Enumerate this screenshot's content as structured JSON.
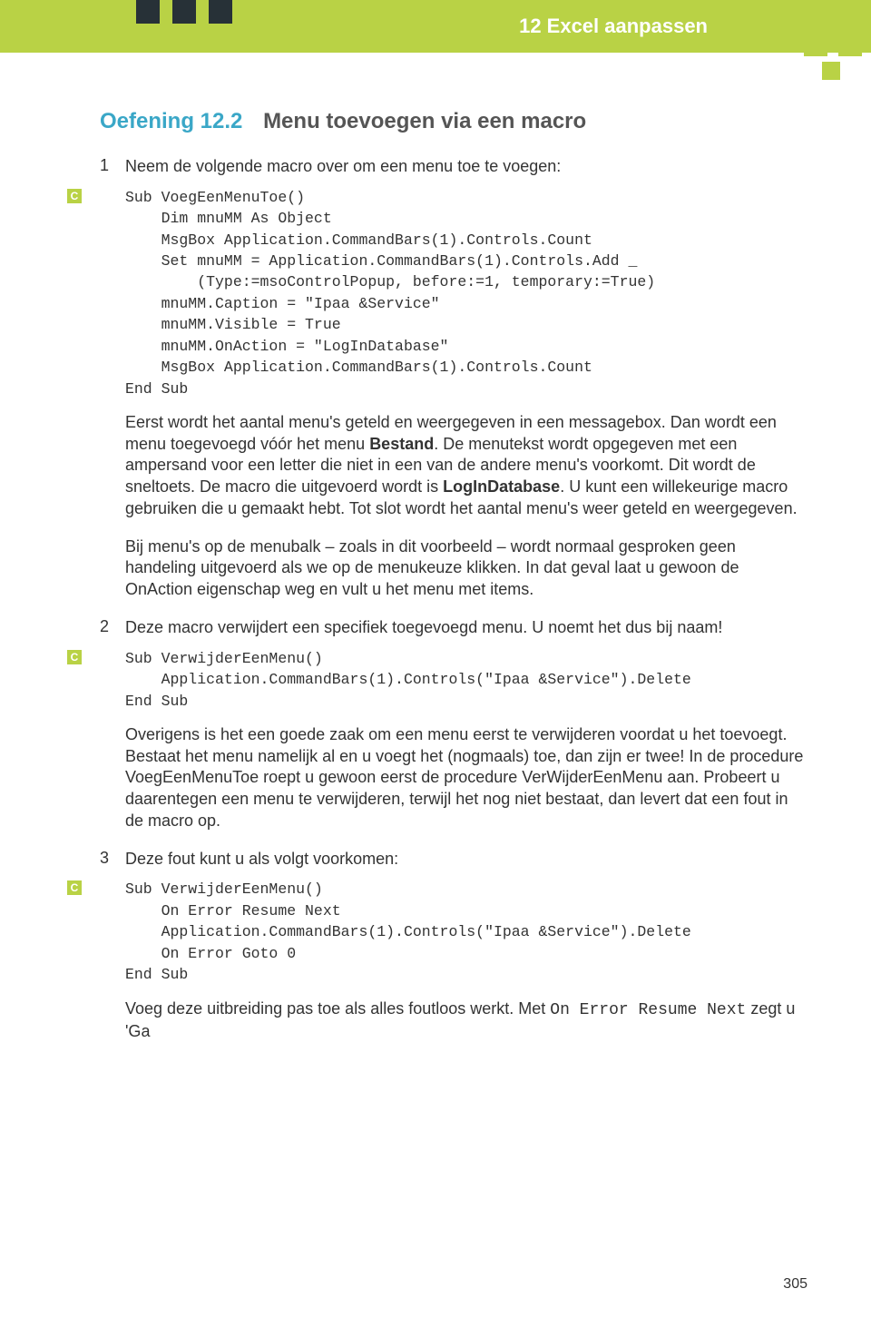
{
  "header": {
    "chapter": "12 Excel aanpassen"
  },
  "exercise": {
    "number": "Oefening 12.2",
    "title": "Menu toevoegen via een macro"
  },
  "steps": {
    "s1": {
      "num": "1",
      "text": "Neem de volgende macro over om een menu toe te voegen:"
    },
    "s2": {
      "num": "2",
      "text": "Deze macro verwijdert een specifiek toegevoegd menu. U noemt het dus bij naam!"
    },
    "s3": {
      "num": "3",
      "text": "Deze fout kunt u als volgt voorkomen:"
    }
  },
  "code": {
    "badge": "C",
    "c1": "Sub VoegEenMenuToe()\n    Dim mnuMM As Object\n    MsgBox Application.CommandBars(1).Controls.Count\n    Set mnuMM = Application.CommandBars(1).Controls.Add _\n        (Type:=msoControlPopup, before:=1, temporary:=True)\n    mnuMM.Caption = \"Ipaa &Service\"\n    mnuMM.Visible = True\n    mnuMM.OnAction = \"LogInDatabase\"\n    MsgBox Application.CommandBars(1).Controls.Count\nEnd Sub",
    "c2": "Sub VerwijderEenMenu()\n    Application.CommandBars(1).Controls(\"Ipaa &Service\").Delete\nEnd Sub",
    "c3": "Sub VerwijderEenMenu()\n    On Error Resume Next\n    Application.CommandBars(1).Controls(\"Ipaa &Service\").Delete\n    On Error Goto 0\nEnd Sub"
  },
  "paras": {
    "p1a": "Eerst wordt het aantal menu's geteld en weergegeven in een messagebox. Dan wordt een menu toegevoegd vóór het menu ",
    "p1b": "Bestand",
    "p1c": ". De menutekst wordt opgegeven met een ampersand voor een letter die niet in een van de andere menu's voorkomt. Dit wordt de sneltoets. De macro die uitgevoerd wordt is ",
    "p1d": "LogInDatabase",
    "p1e": ". U kunt een willekeurige macro gebruiken die u gemaakt hebt. Tot slot wordt het aantal menu's weer geteld en weergegeven.",
    "p2": "Bij menu's op de menubalk – zoals in dit voorbeeld – wordt normaal gesproken geen handeling uitgevoerd als we op de menukeuze klikken. In dat geval laat u gewoon de OnAction eigenschap weg en vult u het menu met items.",
    "p3": "Overigens is het een goede zaak om een menu eerst te verwijderen voordat u het toevoegt. Bestaat het menu namelijk al en u voegt het (nogmaals) toe, dan zijn er twee! In de procedure VoegEenMenuToe roept u gewoon eerst de procedure VerWijderEenMenu aan. Probeert u daarentegen een menu te verwijderen, terwijl het nog niet bestaat, dan levert dat een fout in de macro op.",
    "p4a": "Voeg deze uitbreiding pas toe als alles foutloos werkt. Met ",
    "p4b": "On Error Resume Next",
    "p4c": " zegt u 'Ga"
  },
  "page_number": "305"
}
